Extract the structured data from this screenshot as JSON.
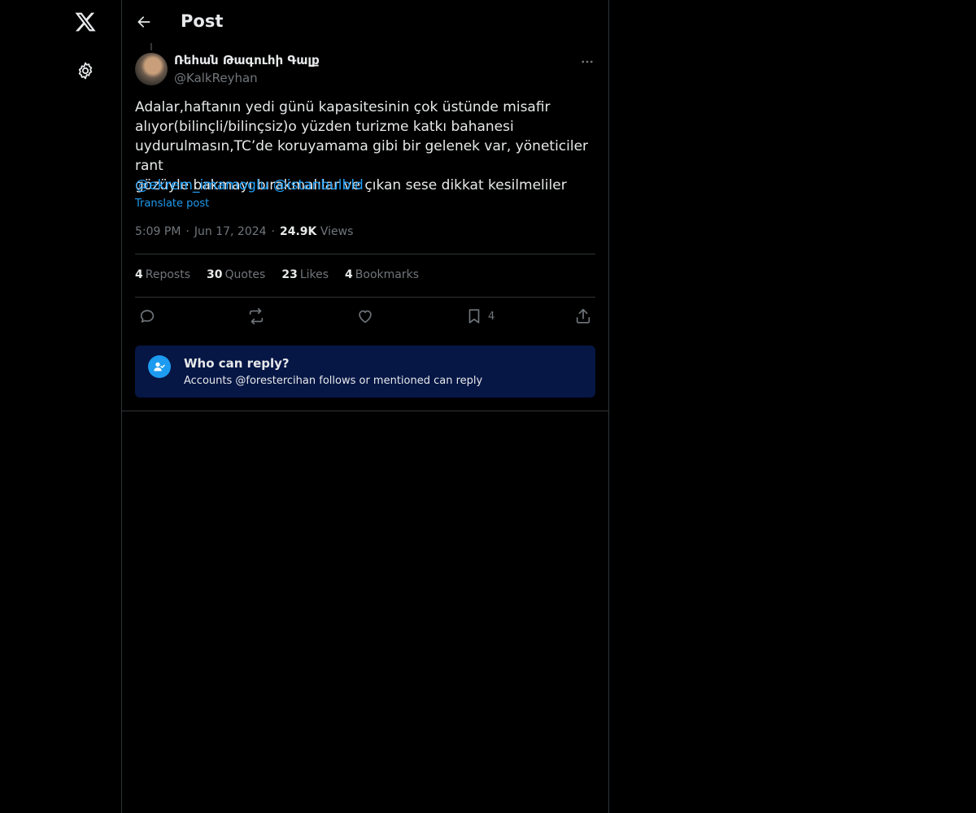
{
  "header": {
    "title": "Post"
  },
  "post": {
    "author_name": "Ռեհան Թագուհի Գալք",
    "author_handle": "@KalkReyhan",
    "text": "Adalar,haftanın yedi günü kapasitesinin çok üstünde misafir\nalıyor(bilinçli/bilinçsiz)o yüzden turizme katkı bahanesi\nuydurulmasın,TC’de koruyamama gibi bir gelenek var, yöneticiler rant\ngözüyle bakmayı bırakmalılar  ve çıkan sese dikkat kesilmeliler",
    "mentions": [
      "@ekrem_imamoglu",
      "@istanbulbld"
    ],
    "translate_label": "Translate post",
    "time": "5:09 PM",
    "date": "Jun 17, 2024",
    "views_count": "24.9K",
    "views_label": "Views",
    "separator": "·"
  },
  "stats": [
    {
      "count": "4",
      "label": "Reposts"
    },
    {
      "count": "30",
      "label": "Quotes"
    },
    {
      "count": "23",
      "label": "Likes"
    },
    {
      "count": "4",
      "label": "Bookmarks"
    }
  ],
  "actions": {
    "bookmark_count": "4"
  },
  "reply_restriction": {
    "title": "Who can reply?",
    "subtitle": "Accounts @forestercihan follows or mentioned can reply"
  },
  "icons": {
    "logo": "x-logo-icon",
    "settings": "gear-icon",
    "back": "arrow-left-icon",
    "more": "more-horizontal-icon",
    "reply": "reply-icon",
    "repost": "repost-icon",
    "like": "heart-icon",
    "bookmark": "bookmark-icon",
    "share": "share-icon",
    "reply_restriction": "user-check-icon"
  },
  "colors": {
    "background": "#000000",
    "text": "#e7e9ea",
    "muted": "#71767b",
    "accent": "#1d9bf0",
    "border": "#2f3336",
    "reply_box": "#061645"
  }
}
